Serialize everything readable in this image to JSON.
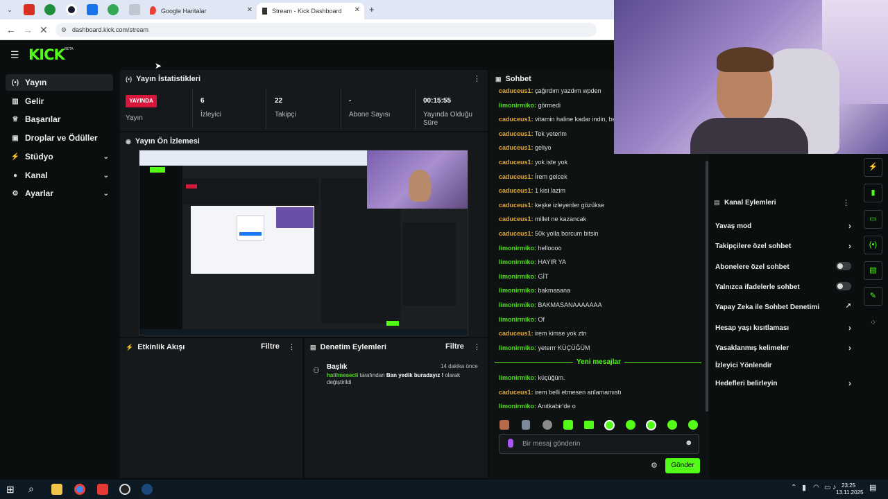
{
  "browser": {
    "tabs": [
      {
        "label": "Google Haritalar"
      },
      {
        "label": "Stream - Kick Dashboard"
      }
    ],
    "url": "dashboard.kick.com/stream",
    "new_tab": "+"
  },
  "app": {
    "logo": "KICK",
    "logo_badge": "BETA"
  },
  "sidebar": {
    "items": [
      {
        "label": "Yayın"
      },
      {
        "label": "Gelir"
      },
      {
        "label": "Başarılar"
      },
      {
        "label": "Droplar ve Ödüller"
      },
      {
        "label": "Stüdyo"
      },
      {
        "label": "Kanal"
      },
      {
        "label": "Ayarlar"
      }
    ]
  },
  "stats": {
    "title": "Yayın İstatistikleri",
    "live_badge": "YAYINDA",
    "live_label": "Yayın",
    "viewers_value": "6",
    "viewers_label": "İzleyici",
    "followers_value": "22",
    "followers_label": "Takipçi",
    "subs_value": "-",
    "subs_label": "Abone Sayısı",
    "duration_value": "00:15:55",
    "duration_label": "Yayında Olduğu Süre"
  },
  "preview": {
    "title": "Yayın Ön İzlemesi"
  },
  "activity": {
    "title": "Etkinlik Akışı",
    "filter": "Filtre"
  },
  "moderation": {
    "title": "Denetim Eylemleri",
    "filter": "Filtre",
    "entry": {
      "title": "Başlık",
      "time": "14 dakika önce",
      "user": "halilmesecli",
      "text_a": "tarafından",
      "value": "Ban yedik buradayız !",
      "text_b": "olarak",
      "text_c": "değiştirildi"
    }
  },
  "chat": {
    "title": "Sohbet",
    "messages": [
      {
        "user": "caduceus1:",
        "text": "çağırdım yazdım wpden",
        "color": "#e0a83a"
      },
      {
        "user": "limonirmiko:",
        "text": "görmedi",
        "color": "#55d826"
      },
      {
        "user": "caduceus1:",
        "text": "vitamin haline kadar indin, be",
        "color": "#e0a83a"
      },
      {
        "user": "caduceus1:",
        "text": "Tek yeterlm",
        "color": "#e0a83a"
      },
      {
        "user": "caduceus1:",
        "text": "geliyo",
        "color": "#e0a83a"
      },
      {
        "user": "caduceus1:",
        "text": "yok iste yok",
        "color": "#e0a83a"
      },
      {
        "user": "caduceus1:",
        "text": "İrem gelcek",
        "color": "#e0a83a"
      },
      {
        "user": "caduceus1:",
        "text": "1 kisi lazim",
        "color": "#e0a83a"
      },
      {
        "user": "caduceus1:",
        "text": "keşke izleyenler gözükse",
        "color": "#e0a83a"
      },
      {
        "user": "caduceus1:",
        "text": "millet ne kazancak",
        "color": "#e0a83a"
      },
      {
        "user": "caduceus1:",
        "text": "50k yolla borcum bitsin",
        "color": "#e0a83a"
      },
      {
        "user": "limonirmiko:",
        "text": "helloooo",
        "color": "#55d826"
      },
      {
        "user": "limonirmiko:",
        "text": "HAYIR YA",
        "color": "#55d826"
      },
      {
        "user": "limonirmiko:",
        "text": "GİT",
        "color": "#55d826"
      },
      {
        "user": "limonirmiko:",
        "text": "bakmasana",
        "color": "#55d826"
      },
      {
        "user": "limonirmiko:",
        "text": "BAKMASANAAAAAAA",
        "color": "#55d826"
      },
      {
        "user": "limonirmiko:",
        "text": "Of",
        "color": "#55d826"
      },
      {
        "user": "caduceus1:",
        "text": "irem kimse yok ztn",
        "color": "#e0a83a"
      },
      {
        "user": "limonirmiko:",
        "text": "yeterrr KÜÇÜĞÜM",
        "color": "#55d826"
      }
    ],
    "new_messages": "Yeni mesajlar",
    "messages_after": [
      {
        "user": "limonirmiko:",
        "text": "küçüğüm.",
        "color": "#55d826"
      },
      {
        "user": "caduceus1:",
        "text": "irem belli etmesen anlamamıstı",
        "color": "#e0a83a"
      },
      {
        "user": "limonirmiko:",
        "text": "Anıtkabir'de o",
        "color": "#55d826"
      }
    ],
    "input_placeholder": "Bir mesaj gönderin",
    "send": "Gönder"
  },
  "channel_actions": {
    "title": "Kanal Eylemleri",
    "items": [
      {
        "label": "Yavaş mod",
        "control": "arrow"
      },
      {
        "label": "Takipçilere özel sohbet",
        "control": "arrow"
      },
      {
        "label": "Abonelere özel sohbet",
        "control": "toggle"
      },
      {
        "label": "Yalnızca ifadelerle sohbet",
        "control": "toggle"
      },
      {
        "label": "Yapay Zeka ile Sohbet Denetimi",
        "control": "external"
      },
      {
        "label": "Hesap yaşı kısıtlaması",
        "control": "arrow"
      },
      {
        "label": "Yasaklanmış kelimeler",
        "control": "arrow"
      },
      {
        "label": "İzleyici Yönlendir",
        "control": "none"
      },
      {
        "label": "Hedefleri belirleyin",
        "control": "arrow"
      }
    ]
  },
  "taskbar": {
    "time": "23:25",
    "date": "13.11.2025"
  },
  "colors": {
    "accent": "#53fc18",
    "live": "#d7163c",
    "user_orange": "#e0a83a",
    "user_green": "#55d826"
  }
}
